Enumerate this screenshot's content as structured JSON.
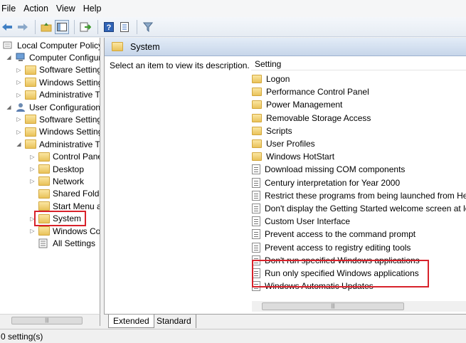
{
  "menu": [
    "File",
    "Action",
    "View",
    "Help"
  ],
  "toolbar": {
    "buttons": [
      "back-arrow-icon",
      "forward-arrow-icon",
      "up-folder-icon",
      "show-hide-tree-icon",
      "export-list-icon",
      "help-icon",
      "properties-icon",
      "filter-icon"
    ]
  },
  "tree": {
    "items": [
      {
        "label": "Local Computer Policy",
        "level": 0,
        "icon": "computer-policy-icon",
        "expander": "none"
      },
      {
        "label": "Computer Configura",
        "level": 1,
        "icon": "computer-icon",
        "expander": "expanded"
      },
      {
        "label": "Software Settings",
        "level": 2,
        "icon": "folder-icon",
        "expander": "collapsed"
      },
      {
        "label": "Windows Setting",
        "level": 2,
        "icon": "folder-icon",
        "expander": "collapsed"
      },
      {
        "label": "Administrative Te",
        "level": 2,
        "icon": "folder-icon",
        "expander": "collapsed"
      },
      {
        "label": "User Configuration",
        "level": 1,
        "icon": "user-icon",
        "expander": "expanded"
      },
      {
        "label": "Software Settings",
        "level": 2,
        "icon": "folder-icon",
        "expander": "collapsed"
      },
      {
        "label": "Windows Setting",
        "level": 2,
        "icon": "folder-icon",
        "expander": "collapsed"
      },
      {
        "label": "Administrative Te",
        "level": 2,
        "icon": "folder-icon",
        "expander": "expanded"
      },
      {
        "label": "Control Panel",
        "level": 3,
        "icon": "folder-icon",
        "expander": "collapsed"
      },
      {
        "label": "Desktop",
        "level": 3,
        "icon": "folder-icon",
        "expander": "collapsed"
      },
      {
        "label": "Network",
        "level": 3,
        "icon": "folder-icon",
        "expander": "collapsed"
      },
      {
        "label": "Shared Folder",
        "level": 3,
        "icon": "folder-icon",
        "expander": "none"
      },
      {
        "label": "Start Menu ar",
        "level": 3,
        "icon": "folder-icon",
        "expander": "none"
      },
      {
        "label": "System",
        "level": 3,
        "icon": "folder-icon",
        "expander": "collapsed",
        "highlighted": true
      },
      {
        "label": "Windows Cor",
        "level": 3,
        "icon": "folder-icon",
        "expander": "collapsed"
      },
      {
        "label": "All Settings",
        "level": 3,
        "icon": "all-settings-icon",
        "expander": "none"
      }
    ]
  },
  "right": {
    "header": "System",
    "description": "Select an item to view its description.",
    "column_header": "Setting",
    "settings": [
      {
        "label": "Logon",
        "icon": "folder-icon"
      },
      {
        "label": "Performance Control Panel",
        "icon": "folder-icon"
      },
      {
        "label": "Power Management",
        "icon": "folder-icon"
      },
      {
        "label": "Removable Storage Access",
        "icon": "folder-icon"
      },
      {
        "label": "Scripts",
        "icon": "folder-icon"
      },
      {
        "label": "User Profiles",
        "icon": "folder-icon"
      },
      {
        "label": "Windows HotStart",
        "icon": "folder-icon"
      },
      {
        "label": "Download missing COM components",
        "icon": "policy-icon"
      },
      {
        "label": "Century interpretation for Year 2000",
        "icon": "policy-icon"
      },
      {
        "label": "Restrict these programs from being launched from Help",
        "icon": "policy-icon"
      },
      {
        "label": "Don't display the Getting Started welcome screen at logon",
        "icon": "policy-icon"
      },
      {
        "label": "Custom User Interface",
        "icon": "policy-icon"
      },
      {
        "label": "Prevent access to the command prompt",
        "icon": "policy-icon"
      },
      {
        "label": "Prevent access to registry editing tools",
        "icon": "policy-icon"
      },
      {
        "label": "Don't run specified Windows applications",
        "icon": "policy-icon"
      },
      {
        "label": "Run only specified Windows applications",
        "icon": "policy-icon",
        "highlighted": true
      },
      {
        "label": "Windows Automatic Updates",
        "icon": "policy-icon"
      }
    ]
  },
  "tabs": [
    "Extended",
    "Standard"
  ],
  "status": "0 setting(s)",
  "colors": {
    "highlight": "#d8222b",
    "folder": "#e9c25a",
    "header": "#c7d6ea"
  }
}
